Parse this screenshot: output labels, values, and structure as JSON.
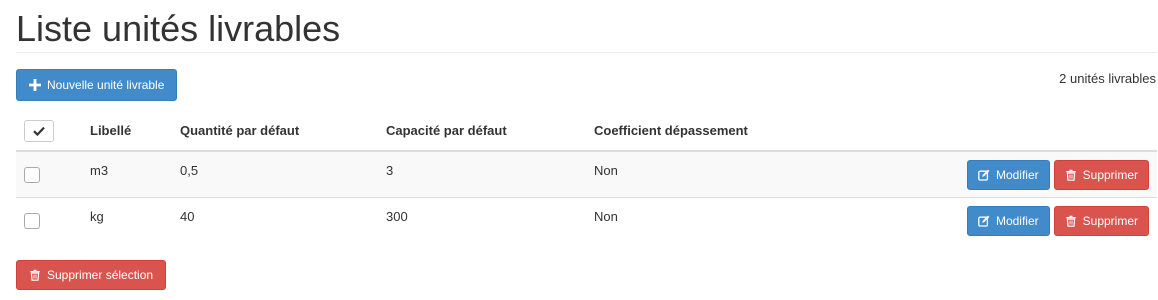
{
  "page": {
    "title": "Liste unités livrables"
  },
  "toolbar": {
    "new_label": "Nouvelle unité livrable",
    "count_text": "2 unités livrables"
  },
  "table": {
    "columns": [
      "Libellé",
      "Quantité par défaut",
      "Capacité par défaut",
      "Coefficient dépassement"
    ],
    "rows": [
      {
        "libelle": "m3",
        "quantite": "0,5",
        "capacite": "3",
        "coefficient": "Non"
      },
      {
        "libelle": "kg",
        "quantite": "40",
        "capacite": "300",
        "coefficient": "Non"
      }
    ],
    "row_actions": {
      "edit_label": "Modifier",
      "delete_label": "Supprimer"
    }
  },
  "footer": {
    "delete_selection_label": "Supprimer sélection"
  },
  "colors": {
    "primary": "#428bca",
    "danger": "#d9534f",
    "stripe": "#f9f9f9",
    "border": "#dddddd"
  },
  "icons": {
    "new": "plus-icon",
    "select_all": "check-icon",
    "edit": "edit-icon",
    "delete": "trash-icon"
  }
}
